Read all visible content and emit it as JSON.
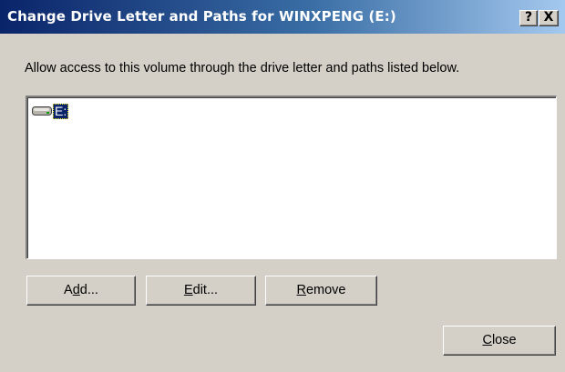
{
  "window": {
    "title": "Change Drive Letter and Paths for WINXPENG (E:)",
    "help_button": "?",
    "close_button": "X"
  },
  "description": "Allow access to this volume through the drive letter and paths listed below.",
  "list": {
    "items": [
      {
        "label": "E:",
        "icon": "drive-icon",
        "selected": true
      }
    ]
  },
  "buttons": {
    "add": {
      "pre": "A",
      "mnemonic": "d",
      "post": "d..."
    },
    "edit": {
      "pre": "",
      "mnemonic": "E",
      "post": "dit..."
    },
    "remove": {
      "pre": "",
      "mnemonic": "R",
      "post": "emove"
    },
    "close": {
      "pre": "",
      "mnemonic": "C",
      "post": "lose"
    }
  },
  "colors": {
    "titlebar_start": "#0a246a",
    "titlebar_end": "#a6caf0",
    "face": "#d4d0c8",
    "selection": "#0a246a"
  }
}
